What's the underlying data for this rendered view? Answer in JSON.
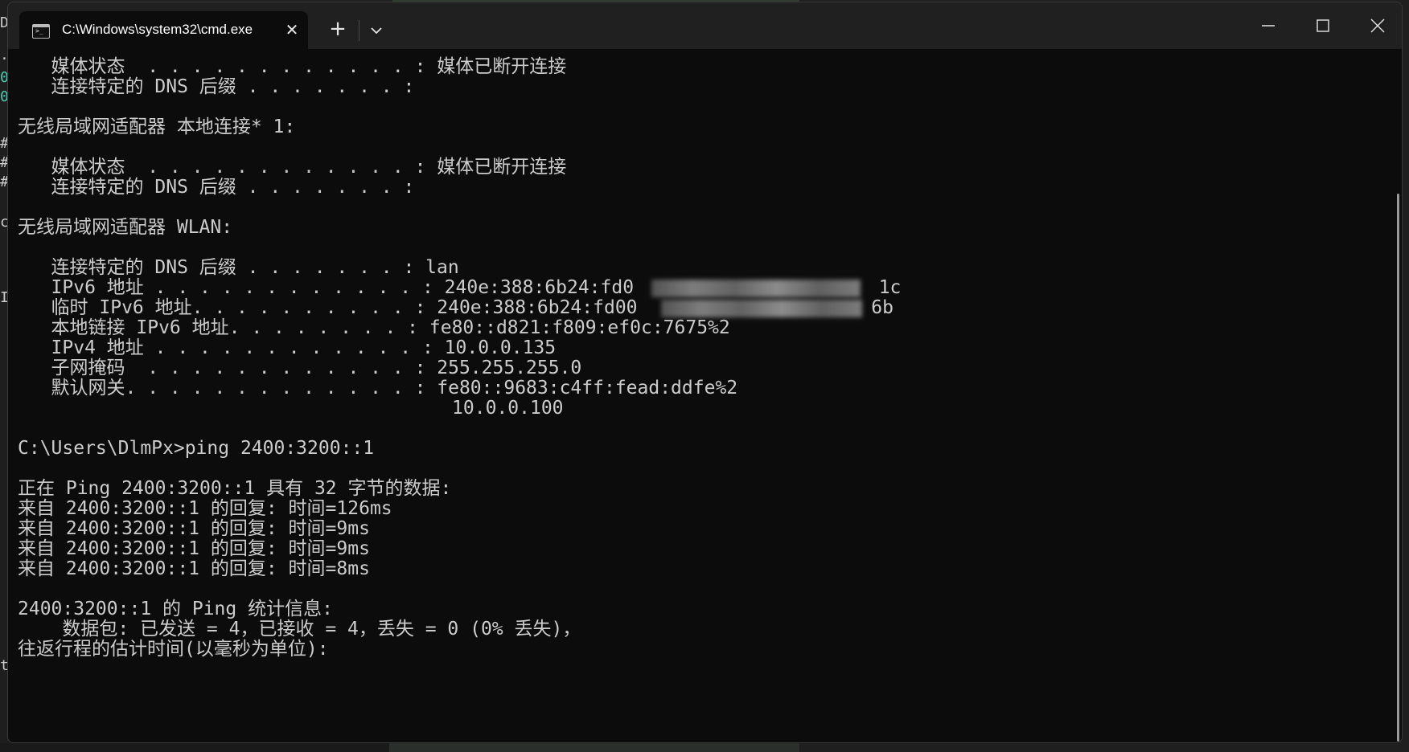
{
  "background": {
    "left_glyphs": [
      "D",
      ".",
      "0",
      "0",
      "#",
      "#",
      "#",
      "c",
      "I",
      "t"
    ]
  },
  "window": {
    "tab_title": "C:\\Windows\\system32\\cmd.exe",
    "tab_close_glyph": "✕",
    "new_tab_glyph": "+",
    "tab_icon_glyph": ">_"
  },
  "terminal": {
    "lines": [
      "   媒体状态  . . . . . . . . . . . . : 媒体已断开连接",
      "   连接特定的 DNS 后缀 . . . . . . . :",
      "",
      "无线局域网适配器 本地连接* 1:",
      "",
      "   媒体状态  . . . . . . . . . . . . : 媒体已断开连接",
      "   连接特定的 DNS 后缀 . . . . . . . :",
      "",
      "无线局域网适配器 WLAN:",
      "",
      "   连接特定的 DNS 后缀 . . . . . . . : lan",
      "   IPv6 地址 . . . . . . . . . . . . : 240e:388:6b24:fd0                      1c",
      "   临时 IPv6 地址. . . . . . . . . . : 240e:388:6b24:fd00                     6b",
      "   本地链接 IPv6 地址. . . . . . . . : fe80::d821:f809:ef0c:7675%2",
      "   IPv4 地址 . . . . . . . . . . . . : 10.0.0.135",
      "   子网掩码  . . . . . . . . . . . . : 255.255.255.0",
      "   默认网关. . . . . . . . . . . . . : fe80::9683:c4ff:fead:ddfe%2",
      "                                       10.0.0.100",
      "",
      "C:\\Users\\DlmPx>ping 2400:3200::1",
      "",
      "正在 Ping 2400:3200::1 具有 32 字节的数据:",
      "来自 2400:3200::1 的回复: 时间=126ms",
      "来自 2400:3200::1 的回复: 时间=9ms",
      "来自 2400:3200::1 的回复: 时间=9ms",
      "来自 2400:3200::1 的回复: 时间=8ms",
      "",
      "2400:3200::1 的 Ping 统计信息:",
      "    数据包: 已发送 = 4，已接收 = 4，丢失 = 0 (0% 丢失)，",
      "往返行程的估计时间(以毫秒为单位):"
    ]
  },
  "colors": {
    "terminal_bg": "#0c0c0c",
    "terminal_fg": "#cccccc",
    "titlebar_bg": "#202020"
  }
}
